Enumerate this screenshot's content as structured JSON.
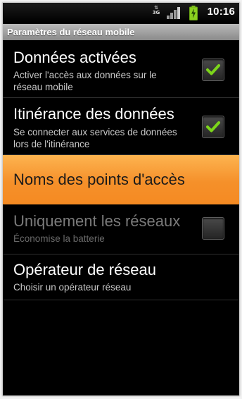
{
  "status_bar": {
    "network_type": "3G",
    "signal_icon": "signal-bars-icon",
    "battery_icon": "battery-charging-icon",
    "time": "10:16"
  },
  "title": "Paramètres du réseau mobile",
  "settings": [
    {
      "title": "Données activées",
      "summary": "Activer l'accès aux données sur le réseau mobile",
      "checked": true
    },
    {
      "title": "Itinérance des données",
      "summary": "Se connecter aux services de données lors de l'itinérance",
      "checked": true
    },
    {
      "title": "Noms des points d'accès"
    },
    {
      "title": "Uniquement les réseaux",
      "summary": "Économise la batterie",
      "checked": false
    },
    {
      "title": "Opérateur de réseau",
      "summary": "Choisir un opérateur réseau"
    }
  ],
  "colors": {
    "accent": "#f7941e",
    "check": "#7cd51a"
  }
}
